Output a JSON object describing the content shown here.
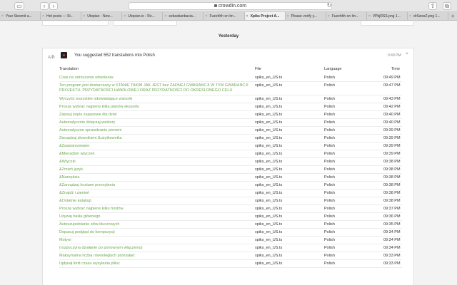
{
  "browser": {
    "address": "crowdin.com",
    "tabs": [
      {
        "title": "Your Steemit a..."
      },
      {
        "title": "Hot posts — St..."
      },
      {
        "title": "Utopian - New..."
      },
      {
        "title": "Utopian.io - Re..."
      },
      {
        "title": "sebastianbacia..."
      },
      {
        "title": "Fuzehhh on Im..."
      },
      {
        "title": "Xpiks Project A...",
        "active": true
      },
      {
        "title": "Please verify y..."
      },
      {
        "title": "Fuzehhh on Im..."
      },
      {
        "title": "VPbjRSS.png 1..."
      },
      {
        "title": "drSwssZ.png 1..."
      }
    ]
  },
  "feed": {
    "day_heading": "Yesterday",
    "card": {
      "summary": "You suggested 552 translations into Polish",
      "time": "9:49 PM",
      "columns": {
        "translation": "Translation",
        "file": "File",
        "language": "Language",
        "time": "Time"
      },
      "rows": [
        {
          "translation": "Czas na odrzucenie odwołania:",
          "file": "xpiks_en_US.ts",
          "language": "Polish",
          "time": "09:49 PM"
        },
        {
          "translation": "Ten program jest dostarczany w STANIE TAKIM JAK JEST bez ŻADNEJ GWARANCJI W TYM GWARANCJI PROJEKTU, PRZYDATNOŚCI HANDLOWEJ ORAZ PRZYDATNOŚCI DO OKREŚLONEGO CELU",
          "file": "xpiks_en_US.ts",
          "language": "Polish",
          "time": "09:47 PM",
          "tall": true
        },
        {
          "translation": "Wyczyść wszystkie odowiadające warunki",
          "file": "xpiks_en_US.ts",
          "language": "Polish",
          "time": "09:43 PM"
        },
        {
          "translation": "Proszę wybrać najpierw kilka planów eksportu",
          "file": "xpiks_en_US.ts",
          "language": "Polish",
          "time": "09:42 PM"
        },
        {
          "translation": "Zapisuj kopie zapasowe dla dzieł",
          "file": "xpiks_en_US.ts",
          "language": "Polish",
          "time": "09:40 PM"
        },
        {
          "translation": "Automatycznie dołączaj wektory",
          "file": "xpiks_en_US.ts",
          "language": "Polish",
          "time": "09:40 PM"
        },
        {
          "translation": "Automatyczne sprawdzanie pisowni",
          "file": "xpiks_en_US.ts",
          "language": "Polish",
          "time": "09:39 PM"
        },
        {
          "translation": "Zarządzaj słownikiem &użytkownika",
          "file": "xpiks_en_US.ts",
          "language": "Polish",
          "time": "09:39 PM"
        },
        {
          "translation": "&Zaawansowane",
          "file": "xpiks_en_US.ts",
          "language": "Polish",
          "time": "09:39 PM"
        },
        {
          "translation": "&Menadżer wtyczek",
          "file": "xpiks_en_US.ts",
          "language": "Polish",
          "time": "09:39 PM"
        },
        {
          "translation": "&Wtyczki",
          "file": "xpiks_en_US.ts",
          "language": "Polish",
          "time": "09:38 PM"
        },
        {
          "translation": "&Zmień język",
          "file": "xpiks_en_US.ts",
          "language": "Polish",
          "time": "09:38 PM"
        },
        {
          "translation": "&Narzędzia",
          "file": "xpiks_en_US.ts",
          "language": "Polish",
          "time": "09:38 PM"
        },
        {
          "translation": "&Zarządzaj hostami przesyłania",
          "file": "xpiks_en_US.ts",
          "language": "Polish",
          "time": "09:38 PM"
        },
        {
          "translation": "&Znajdź i zamień",
          "file": "xpiks_en_US.ts",
          "language": "Polish",
          "time": "09:38 PM"
        },
        {
          "translation": "&Ostatnie katalogi",
          "file": "xpiks_en_US.ts",
          "language": "Polish",
          "time": "09:38 PM"
        },
        {
          "translation": "Proszę wybrać najpierw kilku hostów",
          "file": "xpiks_en_US.ts",
          "language": "Polish",
          "time": "09:37 PM"
        },
        {
          "translation": "Używaj hasła głównego",
          "file": "xpiks_en_US.ts",
          "language": "Polish",
          "time": "09:36 PM"
        },
        {
          "translation": "Autouzupełnianie słów kluczowych",
          "file": "xpiks_en_US.ts",
          "language": "Polish",
          "time": "09:35 PM"
        },
        {
          "translation": "Dopasuj podgląd do kompozycji",
          "file": "xpiks_en_US.ts",
          "language": "Polish",
          "time": "09:34 PM"
        },
        {
          "translation": "Motyw:",
          "file": "xpiks_en_US.ts",
          "language": "Polish",
          "time": "09:34 PM"
        },
        {
          "translation": "(rozpoczyna działanie po ponownym włączeniu)",
          "file": "xpiks_en_US.ts",
          "language": "Polish",
          "time": "09:34 PM"
        },
        {
          "translation": "Maksymalna liczba równoległych przesyłań:",
          "file": "xpiks_en_US.ts",
          "language": "Polish",
          "time": "09:33 PM"
        },
        {
          "translation": "Upłynął limit czasu wysyłania pliku:",
          "file": "xpiks_en_US.ts",
          "language": "Polish",
          "time": "09:33 PM"
        }
      ]
    }
  }
}
